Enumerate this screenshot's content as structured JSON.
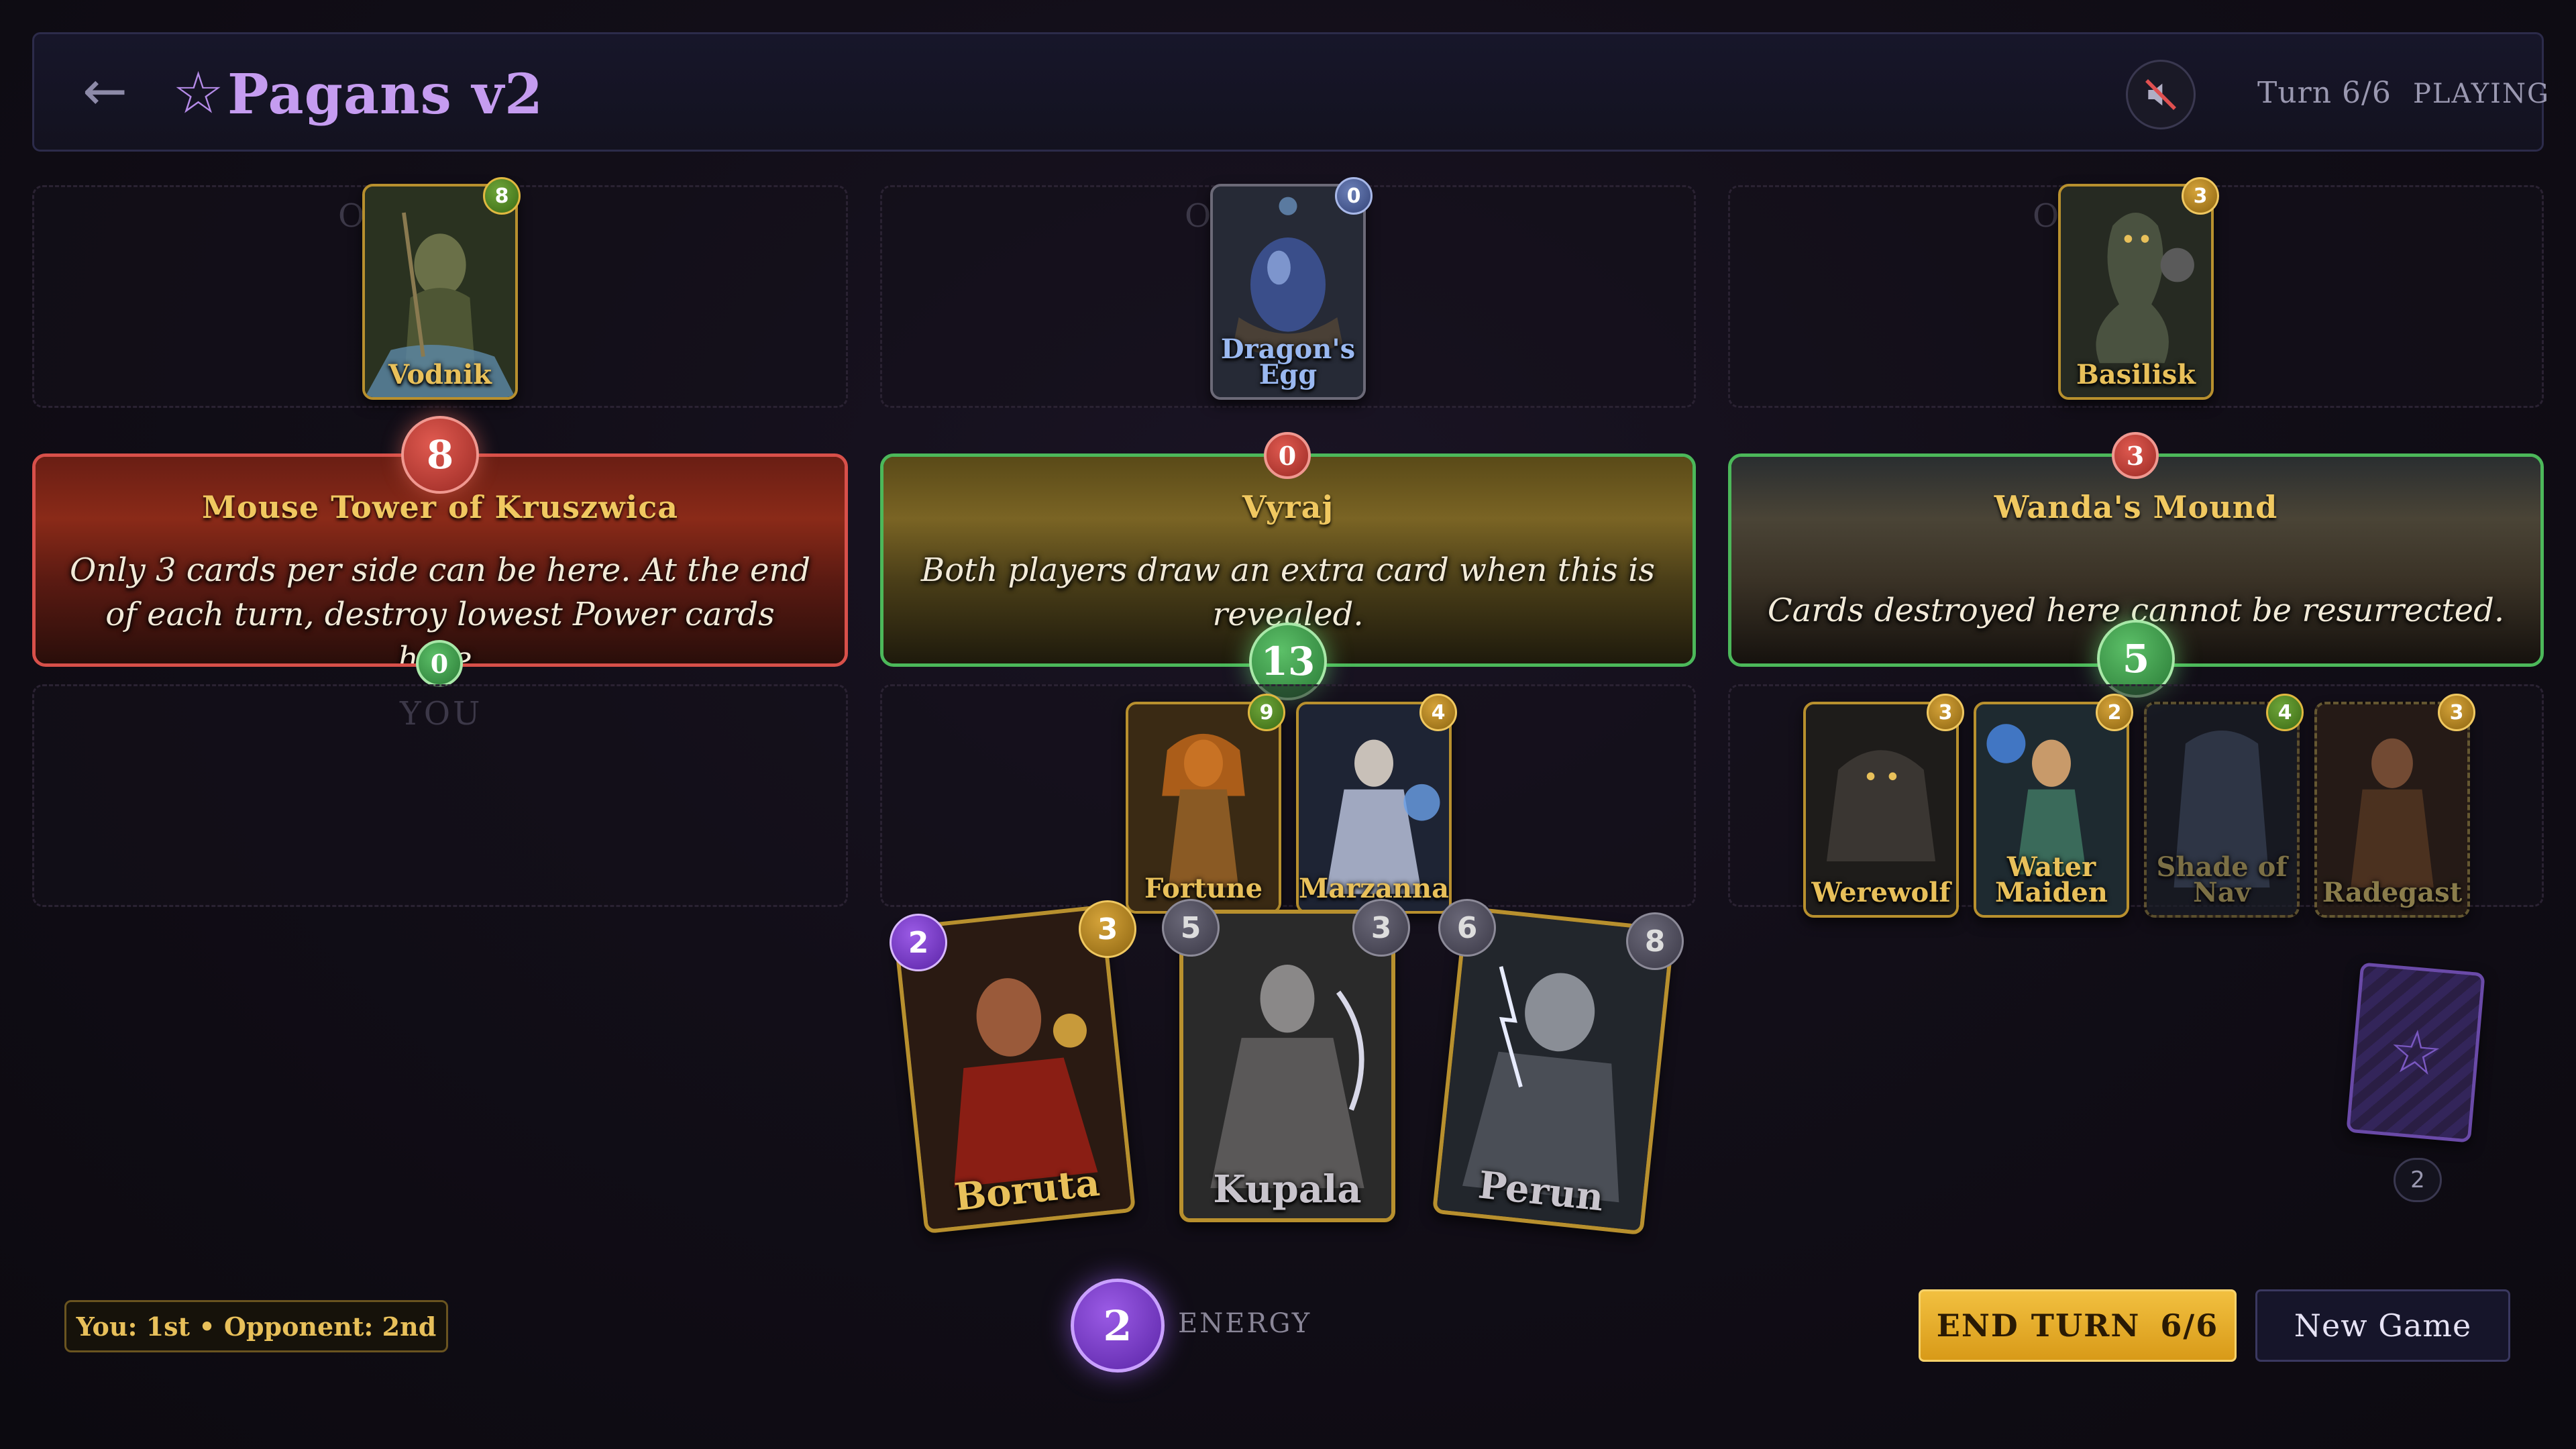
{
  "header": {
    "back_icon": "back-arrow-icon",
    "star_icon": "star-icon",
    "title": "Pagans v2",
    "sound_icon": "muted-speaker-icon",
    "turn": "Turn 6/6",
    "status": "PLAYING"
  },
  "opponent_label": "O    T",
  "player_label": "YOU",
  "opponent_cards": [
    {
      "name": "Vodnik",
      "power": "8"
    },
    {
      "name": "Dragon's Egg",
      "power": "0"
    },
    {
      "name": "Basilisk",
      "power": "3"
    }
  ],
  "locations": [
    {
      "name": "Mouse Tower of Kruszwica",
      "description": "Only 3 cards per side can be here. At the end of each turn, destroy lowest Power cards here.",
      "opponent_score": "8",
      "player_score": "0",
      "accent": "#d8504a"
    },
    {
      "name": "Vyraj",
      "description": "Both players draw an extra card when this is revealed.",
      "opponent_score": "0",
      "player_score": "13",
      "accent": "#4cb85a"
    },
    {
      "name": "Wanda's Mound",
      "description": "Cards destroyed here cannot be resurrected.",
      "opponent_score": "3",
      "player_score": "5",
      "accent": "#4cb85a"
    }
  ],
  "player_cards_loc2": [
    {
      "name": "Fortune",
      "power": "9"
    },
    {
      "name": "Marzanna",
      "power": "4"
    }
  ],
  "player_cards_loc3": [
    {
      "name": "Werewolf",
      "power": "3"
    },
    {
      "name": "Water Maiden",
      "power": "2"
    },
    {
      "name": "Shade of Nav",
      "power": "4"
    },
    {
      "name": "Radegast",
      "power": "3"
    }
  ],
  "hand": [
    {
      "name": "Boruta",
      "cost": "2",
      "power": "3"
    },
    {
      "name": "Kupala",
      "cost": "5",
      "power": "3"
    },
    {
      "name": "Perun",
      "cost": "6",
      "power": "8"
    }
  ],
  "turn_order": "You: 1st • Opponent: 2nd",
  "energy": {
    "value": "2",
    "label": "ENERGY"
  },
  "end_turn": {
    "label": "END TURN",
    "count": "6/6"
  },
  "new_game": "New Game",
  "deck": {
    "count": "2",
    "icon": "star-icon"
  }
}
